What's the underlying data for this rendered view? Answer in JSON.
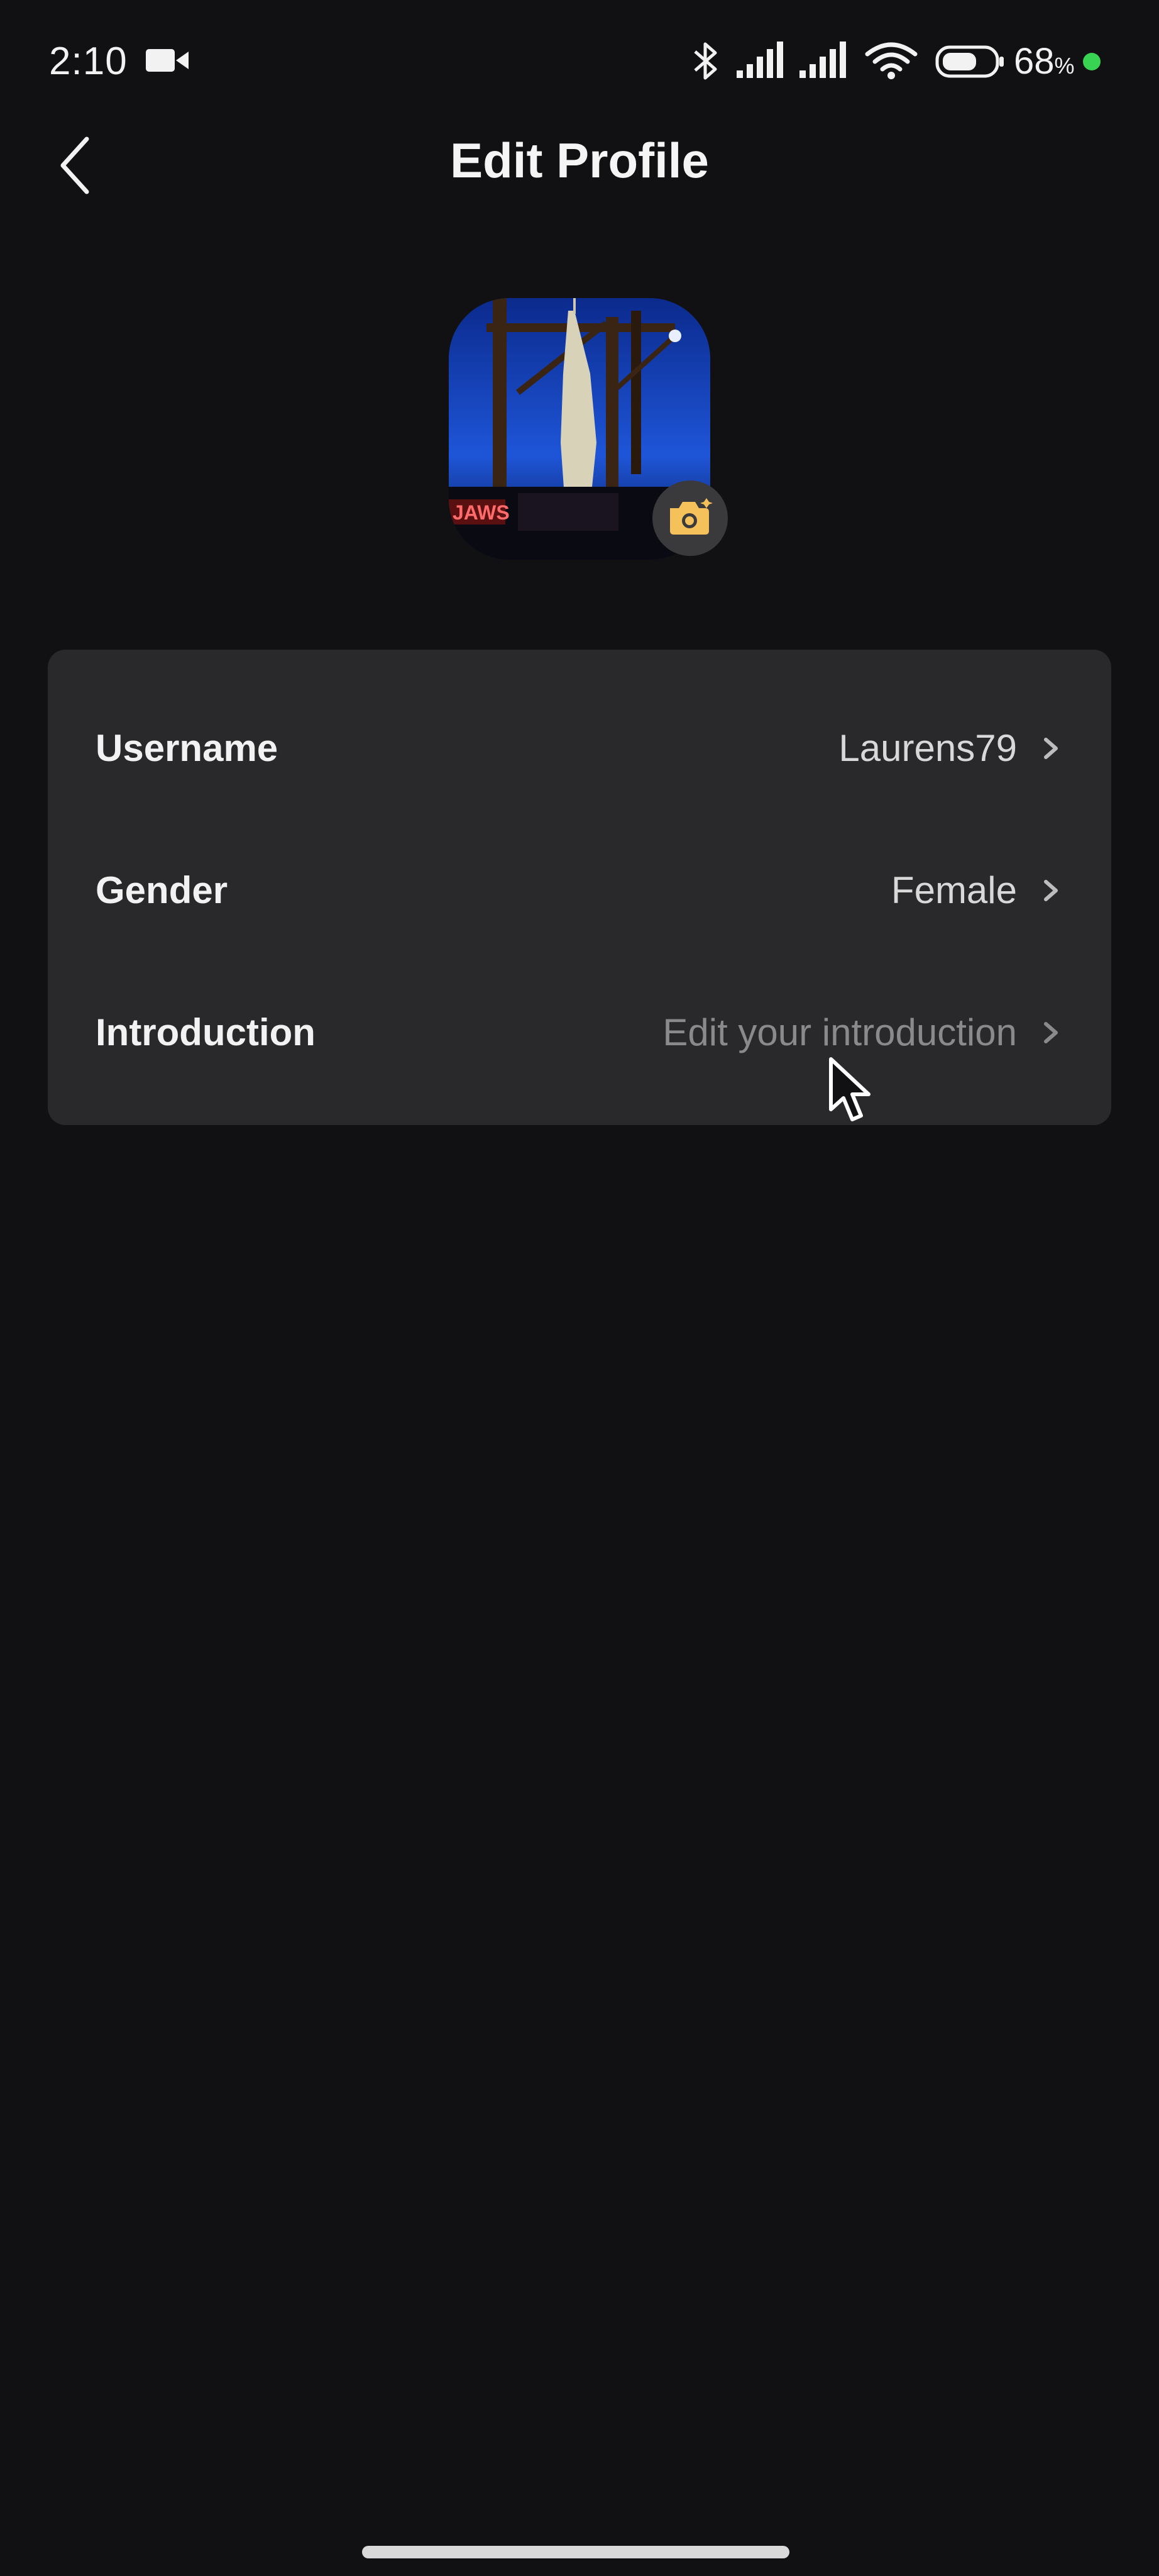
{
  "status_bar": {
    "time": "2:10",
    "battery_percent": "68",
    "battery_percent_sign": "%",
    "icons": [
      "video-camera-icon",
      "bluetooth-icon",
      "signal-icon",
      "signal-icon",
      "wifi-icon",
      "battery-icon"
    ],
    "battery_level": 0.68,
    "charging_dot_color": "#39d353"
  },
  "header": {
    "title": "Edit Profile",
    "back_icon": "chevron-left-icon"
  },
  "avatar": {
    "badge_icon": "camera-icon",
    "badge_icon_color": "#f5c15a"
  },
  "profile_fields": [
    {
      "label": "Username",
      "value": "Laurens79",
      "is_placeholder": false
    },
    {
      "label": "Gender",
      "value": "Female",
      "is_placeholder": false
    },
    {
      "label": "Introduction",
      "value": "Edit your introduction",
      "is_placeholder": true
    }
  ],
  "colors": {
    "background": "#111113",
    "card": "#29292c",
    "placeholder_text": "#8a8a8d"
  }
}
